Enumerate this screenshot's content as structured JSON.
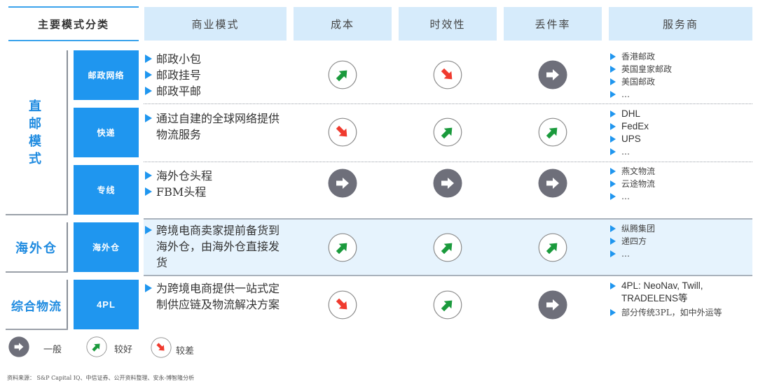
{
  "header": {
    "category": "主要模式分类",
    "columns": [
      "商业模式",
      "成本",
      "时效性",
      "丢件率",
      "服务商"
    ]
  },
  "groups": [
    {
      "label": "直邮模式",
      "chars": [
        "直",
        "邮",
        "模",
        "式"
      ]
    },
    {
      "label": "海外仓"
    },
    {
      "label": "综合物流"
    }
  ],
  "rows": [
    {
      "category": "邮政网络",
      "model": [
        "邮政小包",
        "邮政挂号",
        "邮政平邮"
      ],
      "cost": "good",
      "timeliness": "poor",
      "loss_rate": "neutral",
      "providers": [
        "香港邮政",
        "英国皇家邮政",
        "美国邮政",
        "…"
      ]
    },
    {
      "category": "快递",
      "model": [
        "通过自建的全球网络提供物流服务"
      ],
      "cost": "poor",
      "timeliness": "good",
      "loss_rate": "good",
      "providers": [
        "DHL",
        "FedEx",
        "UPS",
        "…"
      ]
    },
    {
      "category": "专线",
      "model": [
        "海外仓头程",
        "FBM头程"
      ],
      "cost": "neutral",
      "timeliness": "neutral",
      "loss_rate": "neutral",
      "providers": [
        "燕文物流",
        "云途物流",
        "…"
      ]
    },
    {
      "category": "海外仓",
      "model": [
        "跨境电商卖家提前备货到海外仓，由海外仓直接发货"
      ],
      "cost": "good",
      "timeliness": "good",
      "loss_rate": "good",
      "providers": [
        "纵腾集团",
        "递四方",
        "…"
      ]
    },
    {
      "category": "4PL",
      "model": [
        "为跨境电商提供一站式定制供应链及物流解决方案"
      ],
      "cost": "poor",
      "timeliness": "good",
      "loss_rate": "neutral",
      "providers": [
        "4PL: NeoNav, Twill, TRADELENS等",
        "部分传统3PL，如中外运等"
      ]
    }
  ],
  "legend": {
    "neutral": "一般",
    "good": "较好",
    "poor": "较差"
  },
  "icons": {
    "good": "arrow-up-right-green-icon",
    "poor": "arrow-down-right-red-icon",
    "neutral": "arrow-right-gray-circle-icon"
  },
  "colors": {
    "accent": "#1f96ef",
    "header_bg": "#d6ebfb",
    "good": "#1a9a3c",
    "poor": "#f03a2e",
    "neutral": "#6e6f7a"
  },
  "footnote": "资料来源： S&P Capital IQ、中信证券、公开资料整理、安永-博智隆分析"
}
